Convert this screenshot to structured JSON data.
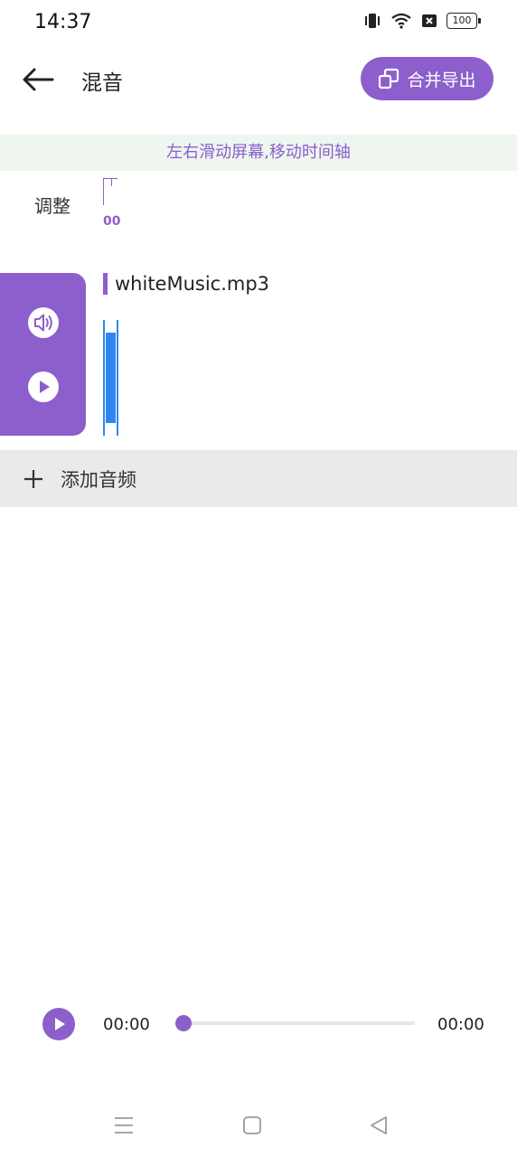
{
  "status_bar": {
    "time": "14:37",
    "battery": "100"
  },
  "header": {
    "title": "混音",
    "export_label": "合并导出"
  },
  "hint": "左右滑动屏幕,移动时间轴",
  "adjust": {
    "label": "调整",
    "ruler_label": "00"
  },
  "track": {
    "name": "whiteMusic.mp3"
  },
  "add_audio": {
    "label": "添加音频"
  },
  "player": {
    "current_time": "00:00",
    "total_time": "00:00",
    "progress": 0
  },
  "colors": {
    "accent": "#8c5fcc",
    "hint_bg": "#eef6ef",
    "add_row_bg": "#e9eaec",
    "waveform": "#2f86f0"
  }
}
